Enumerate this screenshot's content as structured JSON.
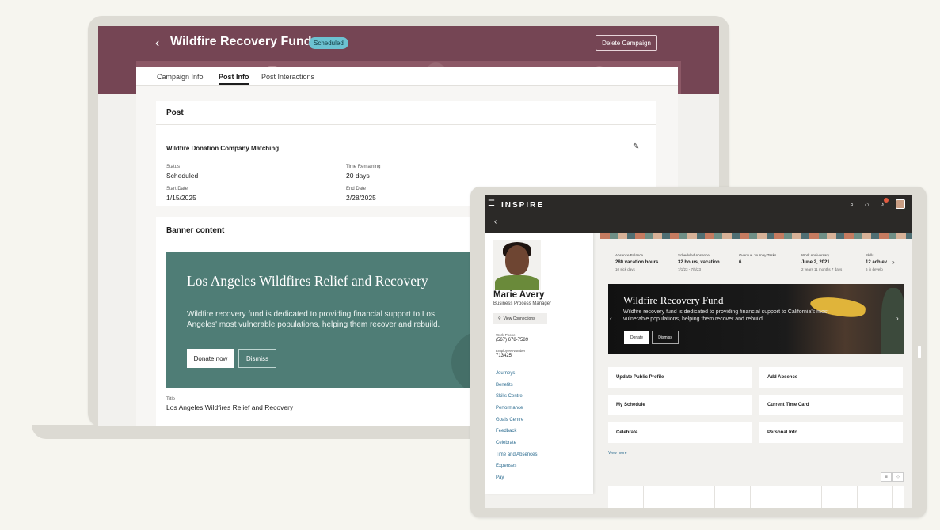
{
  "laptop": {
    "header": {
      "title": "Wildfire Recovery Fund",
      "status_badge": "Scheduled",
      "delete_button": "Delete Campaign",
      "colors": {
        "header_bg": "#754554",
        "badge_bg": "#6cc2d1"
      }
    },
    "tabs": [
      {
        "label": "Campaign Info",
        "active": false
      },
      {
        "label": "Post Info",
        "active": true
      },
      {
        "label": "Post Interactions",
        "active": false
      }
    ],
    "post": {
      "heading": "Post",
      "name": "Wildfire Donation Company Matching",
      "fields": {
        "status_label": "Status",
        "status_value": "Scheduled",
        "time_label": "Time Remaining",
        "time_value": "20 days",
        "start_label": "Start Date",
        "start_value": "1/15/2025",
        "end_label": "End Date",
        "end_value": "2/28/2025"
      }
    },
    "banner": {
      "heading": "Banner content",
      "title": "Los Angeles Wildfires Relief and Recovery",
      "text": "Wildfire recovery fund is dedicated to providing financial support to Los Angeles' most vulnerable populations, helping them recover and rebuild.",
      "donate": "Donate now",
      "dismiss": "Dismiss",
      "title_field_label": "Title",
      "title_field_value": "Los Angeles Wildfires Relief and Recovery",
      "bg_color": "#4f7d76"
    }
  },
  "tablet": {
    "app_name": "INSPIRE",
    "profile": {
      "name": "Marie Avery",
      "role": "Business Process Manager",
      "view_connections": "View Connections",
      "work_phone_label": "Work Phone",
      "work_phone": "(567) 678-7589",
      "employee_number_label": "Employee Number",
      "employee_number": "713425",
      "links": [
        "Journeys",
        "Benefits",
        "Skills Centre",
        "Performance",
        "Goals Centre",
        "Feedback",
        "Celebrate",
        "Time and Absences",
        "Expenses",
        "Pay"
      ]
    },
    "stats": [
      {
        "label": "Absence Balance",
        "value": "280 vacation hours",
        "sub": "10 sick days"
      },
      {
        "label": "Scheduled Absence",
        "value": "32 hours, vacation",
        "sub": "7/1/23 - 7/5/23"
      },
      {
        "label": "Overdue Journey Tasks",
        "value": "6",
        "sub": ""
      },
      {
        "label": "Work Anniversary",
        "value": "June 2, 2021",
        "sub": "2 years 11 months 7 days"
      },
      {
        "label": "Skills",
        "value": "12 achiev",
        "sub": "6 in develo"
      }
    ],
    "hero": {
      "title": "Wildfire Recovery Fund",
      "text": "Wildfire recovery fund is dedicated to providing financial support to California's most vulnerable populations, helping them recover and rebuild.",
      "donate": "Donate",
      "dismiss": "Dismiss"
    },
    "quick_actions": [
      "Update Public Profile",
      "Add Absence",
      "My Schedule",
      "Current Time Card",
      "Celebrate",
      "Personal Info"
    ],
    "view_more": "View more"
  }
}
